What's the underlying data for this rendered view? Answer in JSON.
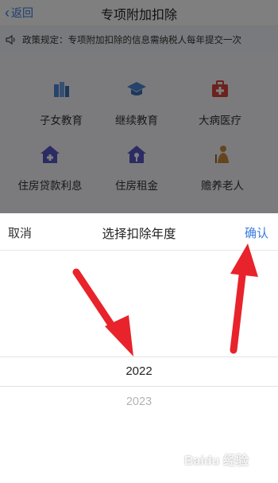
{
  "nav": {
    "back_label": "返回",
    "title": "专项附加扣除"
  },
  "notice": {
    "text": "政策规定：专项附加扣除的信息需纳税人每年提交一次"
  },
  "categories": [
    {
      "label": "子女教育",
      "icon": "children-education-icon"
    },
    {
      "label": "继续教育",
      "icon": "graduation-cap-icon"
    },
    {
      "label": "大病医疗",
      "icon": "medical-kit-icon"
    },
    {
      "label": "住房贷款利息",
      "icon": "house-loan-icon"
    },
    {
      "label": "住房租金",
      "icon": "house-rent-icon"
    },
    {
      "label": "赡养老人",
      "icon": "elderly-support-icon"
    }
  ],
  "picker": {
    "cancel_label": "取消",
    "title": "选择扣除年度",
    "confirm_label": "确认",
    "selected_year": "2022",
    "next_year": "2023"
  },
  "watermark": {
    "text": "Baidu 经验"
  },
  "colors": {
    "accent": "#3a7be0",
    "arrow": "#e8232b"
  }
}
